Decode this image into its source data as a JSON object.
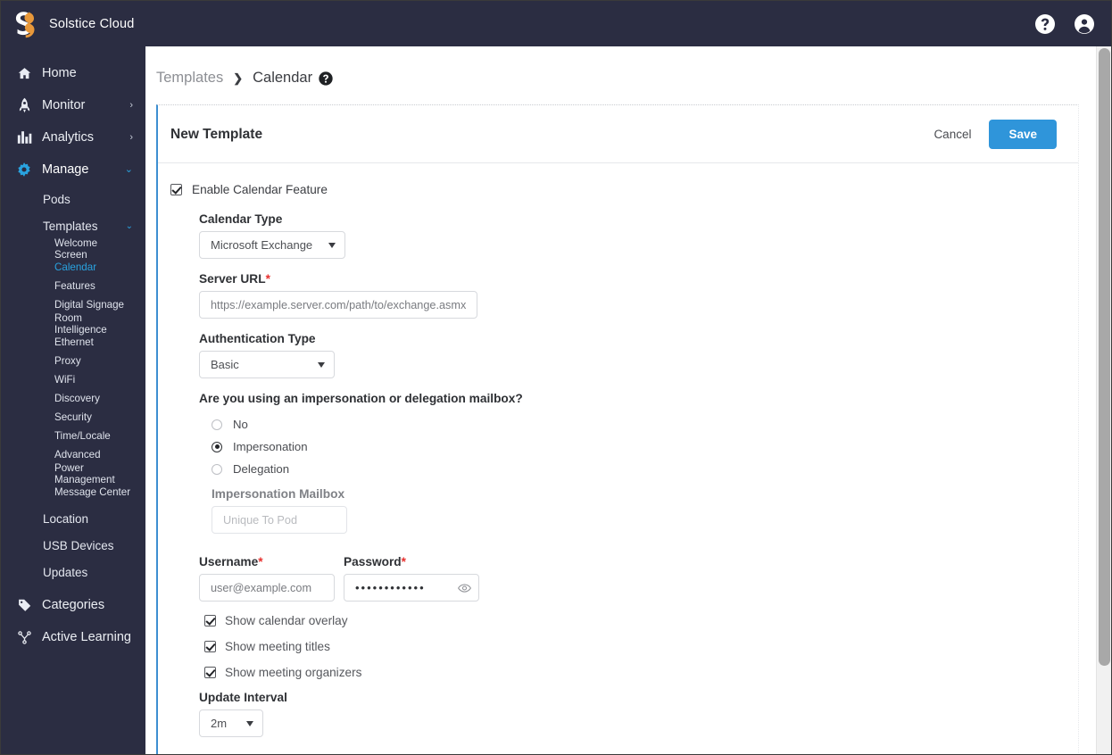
{
  "app": {
    "brand_name": "Solstice Cloud",
    "logo_icon": "solstice-s-logo",
    "help_icon": "help-circle-icon",
    "account_icon": "user-account-icon",
    "accent_blue": "#2f95da",
    "sidebar_bg": "#2b2d42",
    "required_red": "#e8312f"
  },
  "sidebar": {
    "items": [
      {
        "label": "Home",
        "icon": "home-icon",
        "chevron": ""
      },
      {
        "label": "Monitor",
        "icon": "rocket-icon",
        "chevron": "›"
      },
      {
        "label": "Analytics",
        "icon": "bar-chart-icon",
        "chevron": "›"
      },
      {
        "label": "Manage",
        "icon": "gear-icon",
        "chevron": "⌄"
      }
    ],
    "manage_children": [
      {
        "label": "Pods"
      },
      {
        "label": "Templates",
        "chevron": "⌄"
      }
    ],
    "template_children": [
      {
        "label": "Welcome Screen",
        "active": false
      },
      {
        "label": "Calendar",
        "active": true
      },
      {
        "label": "Features",
        "active": false
      },
      {
        "label": "Digital Signage",
        "active": false
      },
      {
        "label": "Room Intelligence",
        "active": false
      },
      {
        "label": "Ethernet",
        "active": false
      },
      {
        "label": "Proxy",
        "active": false
      },
      {
        "label": "WiFi",
        "active": false
      },
      {
        "label": "Discovery",
        "active": false
      },
      {
        "label": "Security",
        "active": false
      },
      {
        "label": "Time/Locale",
        "active": false
      },
      {
        "label": "Advanced",
        "active": false
      },
      {
        "label": "Power Management",
        "active": false
      },
      {
        "label": "Message Center",
        "active": false
      }
    ],
    "manage_tail": [
      {
        "label": "Location"
      },
      {
        "label": "USB Devices"
      },
      {
        "label": "Updates"
      }
    ],
    "bottom_items": [
      {
        "label": "Categories",
        "icon": "tag-icon"
      },
      {
        "label": "Active Learning",
        "icon": "sitemap-icon"
      }
    ]
  },
  "breadcrumb": {
    "parent": "Templates",
    "separator": "❯",
    "current": "Calendar",
    "help_icon": "help-circle-icon"
  },
  "card": {
    "title": "New Template",
    "cancel_label": "Cancel",
    "save_label": "Save"
  },
  "form": {
    "enable_calendar": {
      "label": "Enable Calendar Feature",
      "checked": true
    },
    "calendar_type": {
      "label": "Calendar Type",
      "value": "Microsoft Exchange",
      "caret_icon": "chevron-down-icon"
    },
    "server_url": {
      "label": "Server URL",
      "required_marker": "*",
      "value": "",
      "placeholder": "https://example.server.com/path/to/exchange.asmx"
    },
    "auth_type": {
      "label": "Authentication Type",
      "value": "Basic",
      "caret_icon": "chevron-down-icon"
    },
    "mailbox_question": {
      "label": "Are you using an impersonation or delegation mailbox?",
      "options": [
        {
          "label": "No",
          "selected": false
        },
        {
          "label": "Impersonation",
          "selected": true
        },
        {
          "label": "Delegation",
          "selected": false
        }
      ]
    },
    "impersonation_mailbox": {
      "label": "Impersonation Mailbox",
      "value": "",
      "placeholder": "Unique To Pod",
      "disabled": true
    },
    "username": {
      "label": "Username",
      "required_marker": "*",
      "value": "",
      "placeholder": "user@example.com"
    },
    "password": {
      "label": "Password",
      "required_marker": "*",
      "masked_value": "••••••••••••",
      "reveal_icon": "eye-icon"
    },
    "toggles": [
      {
        "label": "Show calendar overlay",
        "checked": true
      },
      {
        "label": "Show meeting titles",
        "checked": true
      },
      {
        "label": "Show meeting organizers",
        "checked": true
      }
    ],
    "update_interval": {
      "label": "Update Interval",
      "value": "2m",
      "caret_icon": "chevron-down-icon"
    }
  },
  "scrollbar": {
    "name": "vertical-scrollbar",
    "thumb_name": "scrollbar-thumb"
  }
}
